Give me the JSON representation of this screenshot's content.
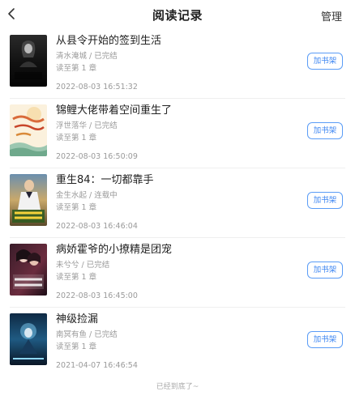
{
  "nav": {
    "title": "阅读记录",
    "manage_label": "管理"
  },
  "books": [
    {
      "title": "从县令开始的签到生活",
      "meta": "清水淹城 / 已完结",
      "progress": "读至第 1 章",
      "time": "2022-08-03 16:51:32",
      "button": "加书架",
      "cover_text": "从县令开始的签到生活"
    },
    {
      "title": "锦鲤大佬带着空间重生了",
      "meta": "浮世落华 / 已完结",
      "progress": "读至第 1 章",
      "time": "2022-08-03 16:50:09",
      "button": "加书架",
      "cover_text": "锦鲤大佬带着空间重生了"
    },
    {
      "title": "重生84：一切都靠手",
      "meta": "金生水起 / 连载中",
      "progress": "读至第 1 章",
      "time": "2022-08-03 16:46:04",
      "button": "加书架",
      "cover_text": "重生84一切都靠手"
    },
    {
      "title": "病娇霍爷的小撩精是团宠",
      "meta": "未兮兮 / 已完结",
      "progress": "读至第 1 章",
      "time": "2022-08-03 16:45:00",
      "button": "加书架",
      "cover_text": "病娇霍爷的小撩精"
    },
    {
      "title": "神级捡漏",
      "meta": "南冥有鱼 / 已完结",
      "progress": "读至第 1 章",
      "time": "2021-04-07 16:46:54",
      "button": "加书架",
      "cover_text": "神级捡漏"
    }
  ],
  "footer": {
    "text": "已经到底了~"
  },
  "colors": {
    "accent": "#3f87f2",
    "muted_text": "#9a9a9a",
    "divider": "#efefef"
  },
  "icons": {
    "back": "chevron-left-icon"
  }
}
